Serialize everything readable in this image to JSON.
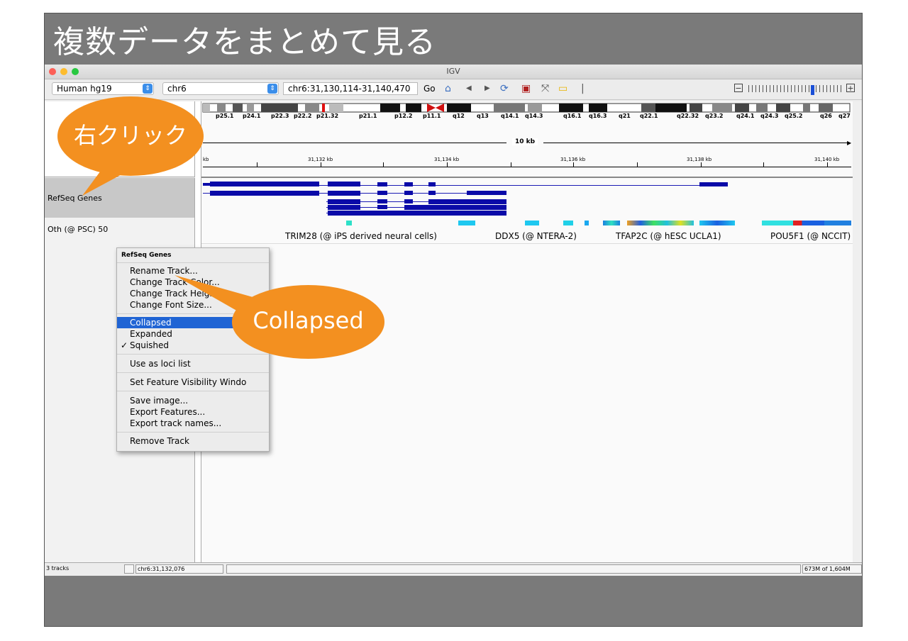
{
  "slide": {
    "title": "複数データをまとめて見る"
  },
  "window": {
    "title": "IGV"
  },
  "toolbar": {
    "genome": "Human hg19",
    "chromosome": "chr6",
    "locus": "chr6:31,130,114-31,140,470",
    "go_label": "Go",
    "zoom_minus": "−",
    "zoom_plus": "+"
  },
  "ideogram": {
    "bands": [
      "p25.1",
      "p24.1",
      "p22.3",
      "p22.2",
      "p21.32",
      "p21.1",
      "p12.2",
      "p11.1",
      "q12",
      "q13",
      "q14.1",
      "q14.3",
      "q16.1",
      "q16.3",
      "q21",
      "q22.1",
      "q22.32",
      "q23.2",
      "q24.1",
      "q24.3",
      "q25.2",
      "q26",
      "q27"
    ]
  },
  "ruler": {
    "span": "10 kb",
    "labels": [
      "kb",
      "31,132 kb",
      "31,134 kb",
      "31,136 kb",
      "31,138 kb",
      "31,140 kb"
    ]
  },
  "tracks": {
    "refseq": "RefSeq Genes",
    "expression": "Oth (@ PSC) 50"
  },
  "expression_labels": [
    "TRIM28 (@ iPS derived neural cells)",
    "DDX5 (@ NTERA-2)",
    "TFAP2C (@ hESC UCLA1)",
    "POU5F1 (@ NCCIT)"
  ],
  "menu": {
    "header": "RefSeq Genes",
    "items": {
      "rename": "Rename Track...",
      "color": "Change Track Color...",
      "height": "Change Track Height...",
      "font": "Change Font Size...",
      "collapsed": "Collapsed",
      "expanded": "Expanded",
      "squished": "Squished",
      "loci": "Use as loci list",
      "visibility": "Set Feature Visibility Windo",
      "save": "Save image...",
      "export_features": "Export Features...",
      "export_names": "Export track names...",
      "remove": "Remove Track"
    },
    "checkmark": "✓"
  },
  "callouts": {
    "right_click": "右クリック",
    "collapsed": "Collapsed"
  },
  "status": {
    "tracks": "3 tracks",
    "position": "chr6:31,132,076",
    "memory": "673M of 1,604M"
  },
  "colors": {
    "accent_orange": "#f39020",
    "menu_selection": "#2064d4",
    "gene_blue": "#0a0aa8"
  }
}
